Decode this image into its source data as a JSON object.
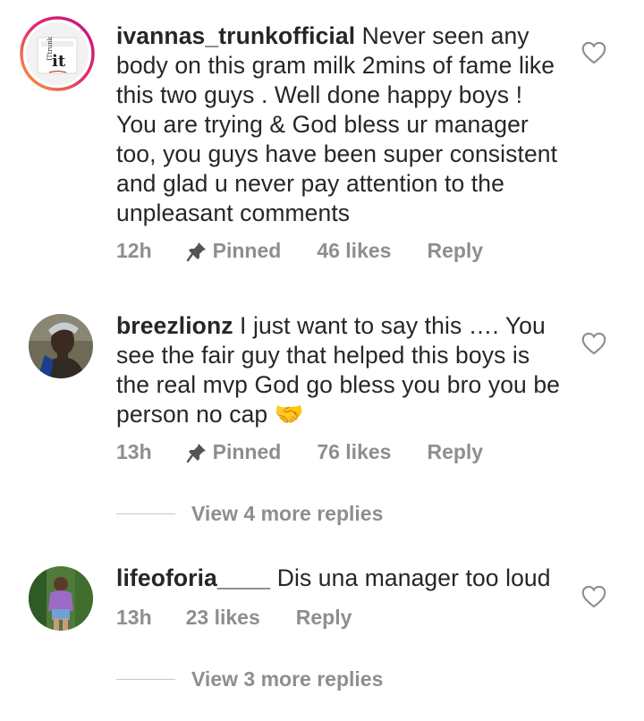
{
  "comments": [
    {
      "username": "ivannas_trunkofficial",
      "text": "Never seen any body on this gram milk 2mins of fame like this two guys . Well done happy boys ! You are trying & God bless ur manager too, you guys have been super consistent and glad u never pay attention to the unpleasant comments",
      "time": "12h",
      "pinned": "Pinned",
      "likes": "46 likes",
      "reply": "Reply",
      "avatar_logo_text": "it"
    },
    {
      "username": "breezlionz",
      "text": "I just want to say this …. You see the fair guy that helped this boys is the real mvp God go bless you bro you be person no cap 🤝",
      "time": "13h",
      "pinned": "Pinned",
      "likes": "76 likes",
      "reply": "Reply",
      "view_more": "View 4 more replies"
    },
    {
      "username": "lifeoforia____",
      "text": "Dis una manager too loud",
      "time": "13h",
      "likes": "23 likes",
      "reply": "Reply",
      "view_more": "View 3 more replies"
    }
  ],
  "colors": {
    "text": "#262626",
    "meta": "#8e8e8e",
    "story_ring_start": "#f9a13a",
    "story_ring_end": "#c4127f"
  },
  "icons": [
    "heart-outline-icon",
    "pin-icon"
  ]
}
